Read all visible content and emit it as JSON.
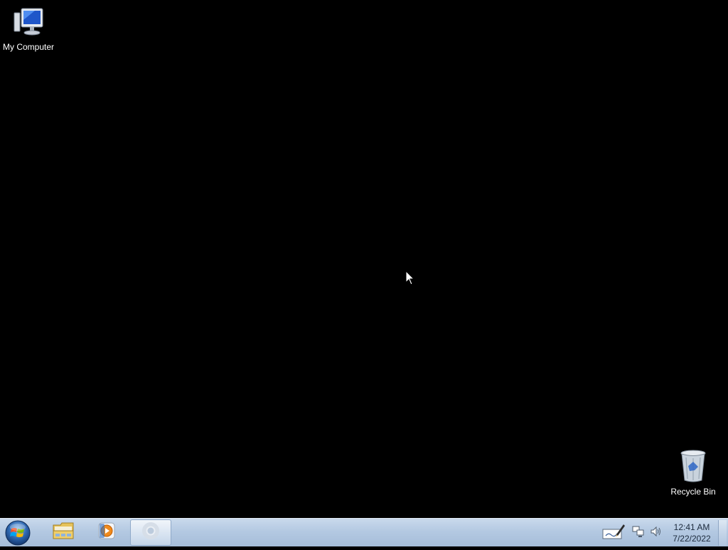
{
  "desktop": {
    "background_color": "#000000",
    "icons": [
      {
        "label": "My Computer",
        "icon": "my-computer-icon"
      },
      {
        "label": "Recycle Bin",
        "icon": "recycle-bin-icon"
      }
    ]
  },
  "taskbar": {
    "start_icon": "windows-start-orb-icon",
    "pinned": [
      {
        "icon": "windows-explorer-icon",
        "active": false
      },
      {
        "icon": "media-player-icon",
        "active": false
      },
      {
        "icon": "chrome-icon",
        "active": true
      }
    ],
    "tray": {
      "icons": [
        "pen-tablet-icon",
        "network-icon",
        "volume-icon"
      ],
      "time": "12:41 AM",
      "date": "7/22/2022"
    }
  },
  "colors": {
    "taskbar": "#b4c9e2",
    "desktop": "#000000",
    "label_text": "#ffffff"
  }
}
